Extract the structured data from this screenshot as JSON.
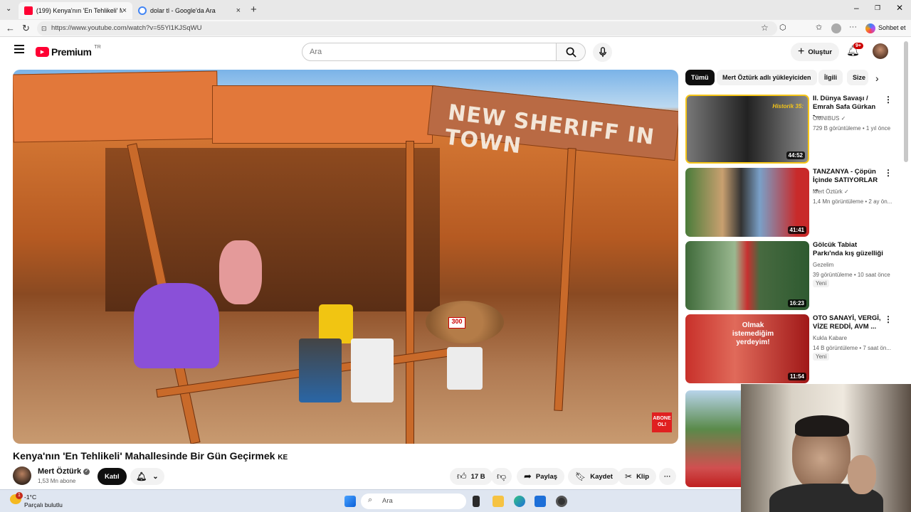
{
  "browser": {
    "tabs": [
      {
        "label": "(199) Kenya'nın 'En Tehlikeli' Maha",
        "favicon": "youtube-icon",
        "active": true
      },
      {
        "label": "dolar tl - Google'da Ara",
        "favicon": "google-icon",
        "active": false
      }
    ],
    "url": "https://www.youtube.com/watch?v=55Yl1KJSqWU",
    "copilot_label": "Sohbet et"
  },
  "header": {
    "logo_text": "Premium",
    "region": "TR",
    "search_placeholder": "Ara",
    "create_label": "Oluştur",
    "notification_count": "9+"
  },
  "video": {
    "sign_text": "NEW SHERIFF IN TOWN",
    "title": "Kenya'nın 'En Tehlikeli' Mahallesinde Bir Gün Geçirmek",
    "title_suffix": "KE",
    "watermark": "ABONE OL!",
    "price_tag": "300"
  },
  "channel": {
    "name": "Mert Öztürk",
    "subscribers": "1,53 Mn abone",
    "join_label": "Katıl"
  },
  "actions": {
    "likes": "17 B",
    "share": "Paylaş",
    "save": "Kaydet",
    "clip": "Klip"
  },
  "chips": [
    "Tümü",
    "Mert Öztürk adlı yükleyiciden",
    "İlgili",
    "Size"
  ],
  "related": [
    {
      "title_line1": "II. Dünya Savaşı /",
      "title_line2": "Emrah Safa Gürkan -...",
      "channel": "OMNIBUS",
      "verified": true,
      "meta": "729 B görüntüleme • 1 yıl önce",
      "duration": "44:52",
      "thumb_label": "Historik 35:",
      "badge": ""
    },
    {
      "title_line1": "TANZANYA - Çöpün",
      "title_line2": "İçinde SATIYORLAR ...",
      "channel": "Mert Öztürk",
      "verified": true,
      "meta": "1,4 Mn görüntüleme • 2 ay ön...",
      "duration": "41:41",
      "thumb_label": "",
      "badge": ""
    },
    {
      "title_line1": "Gölcük Tabiat",
      "title_line2": "Parkı'nda kış güzelliği",
      "channel": "Gezelim",
      "verified": false,
      "meta": "39 görüntüleme • 10 saat önce",
      "duration": "16:23",
      "thumb_label": "",
      "badge": "Yeni"
    },
    {
      "title_line1": "OTO SANAYİ, VERGİ,",
      "title_line2": "VİZE REDDİ, AVM ...",
      "channel": "Kukla Kabare",
      "verified": false,
      "meta": "14 B görüntüleme • 7 saat ön...",
      "duration": "11:54",
      "thumb_label": "Olmak istemediğim yerdeyim!",
      "badge": "Yeni"
    }
  ],
  "taskbar": {
    "weather_temp": "-1°C",
    "weather_desc": "Parçalı bulutlu",
    "weather_badge": "1",
    "search_placeholder": "Ara"
  },
  "colors": {
    "youtube_red": "#ff0033",
    "edge_bar": "#f7f7f7",
    "taskbar": "#dfe6f1"
  }
}
